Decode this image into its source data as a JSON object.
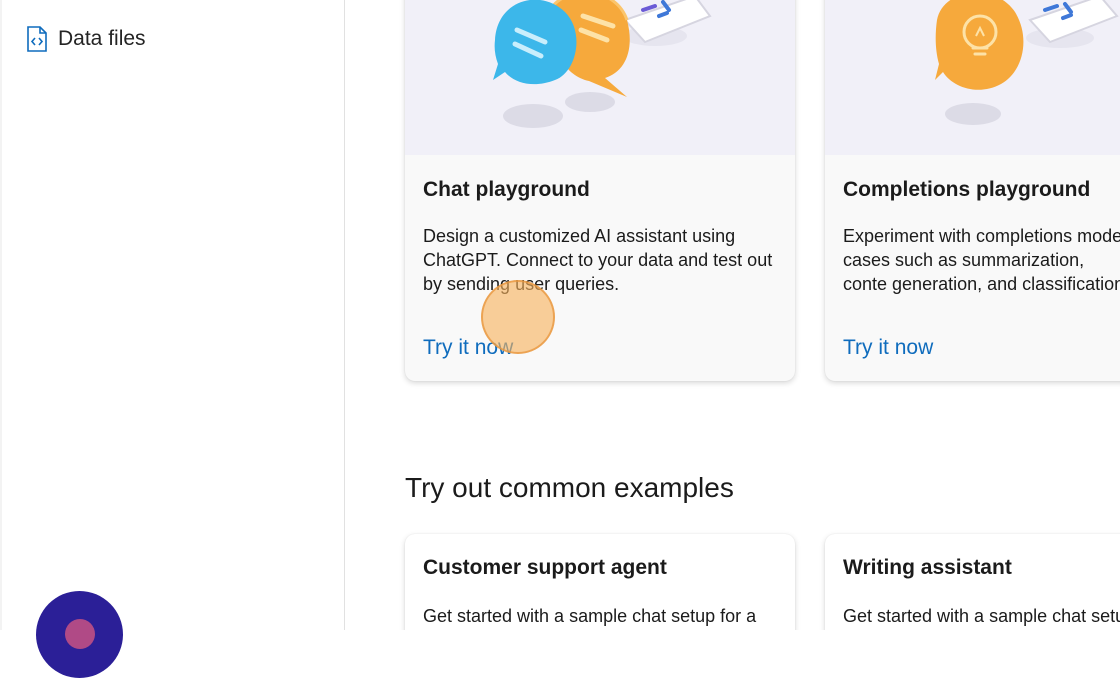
{
  "sidebar": {
    "nav_items": [
      {
        "label": "Data files",
        "icon": "code-file-icon"
      }
    ]
  },
  "playgrounds": [
    {
      "title": "Chat playground",
      "description": "Design a customized AI assistant using ChatGPT. Connect to your data and test out by sending user queries.",
      "link": "Try it now",
      "illustration": "chat-bubbles-illustration"
    },
    {
      "title": "Completions playground",
      "description": "Experiment with completions mode cases such as summarization, conte generation, and classification.",
      "link": "Try it now",
      "illustration": "lightbulb-illustration"
    }
  ],
  "examples": {
    "section_title": "Try out common examples",
    "cards": [
      {
        "title": "Customer support agent",
        "description": "Get started with a sample chat setup for a"
      },
      {
        "title": "Writing assistant",
        "description": "Get started with a sample chat setup f"
      }
    ]
  },
  "colors": {
    "link": "#0f6cbd",
    "banner": "#f1f0f8",
    "avatar": "#2b1f97",
    "click_indicator": "#f7b25c"
  }
}
